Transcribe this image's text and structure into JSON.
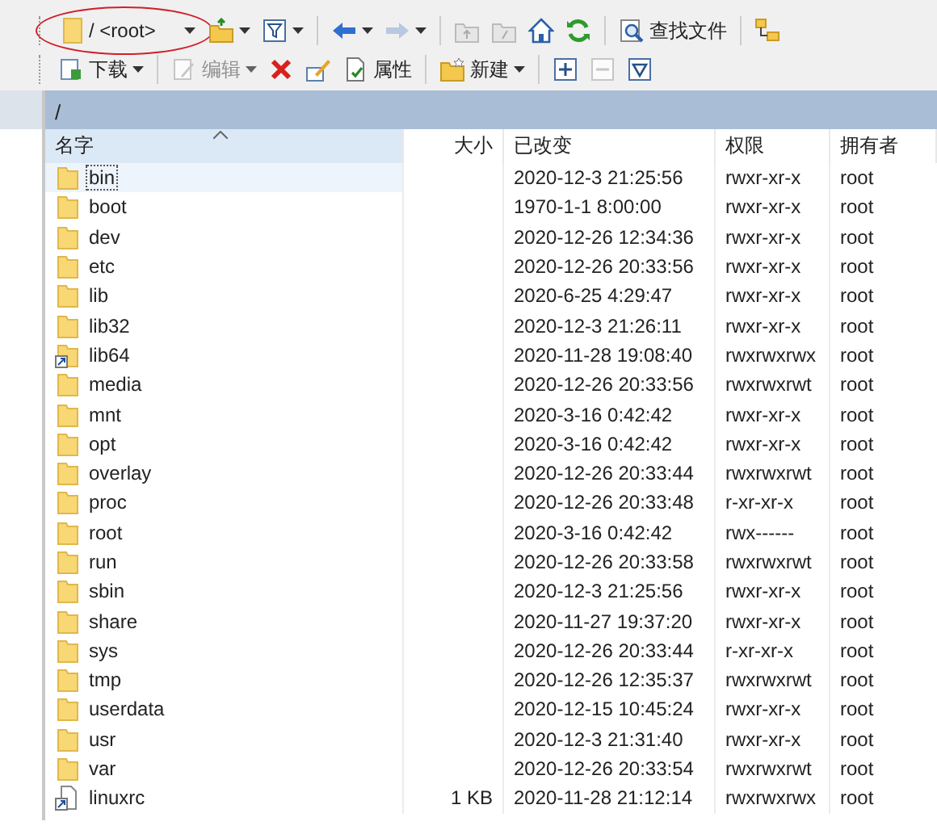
{
  "toolbar_top": {
    "path_combo": "/ <root>",
    "find_button": "查找文件",
    "back_enabled": true,
    "forward_enabled": false
  },
  "toolbar_bottom": [
    {
      "kind": "download",
      "label": "下载",
      "dropdown": true,
      "disabled": false
    },
    {
      "kind": "edit",
      "label": "编辑",
      "dropdown": true,
      "disabled": true
    },
    {
      "kind": "delete",
      "disabled": false
    },
    {
      "kind": "rename",
      "disabled": false
    },
    {
      "kind": "properties",
      "label": "属性",
      "disabled": false
    },
    {
      "kind": "new",
      "label": "新建",
      "dropdown": true,
      "disabled": false
    },
    {
      "kind": "plus",
      "disabled": false
    },
    {
      "kind": "minus",
      "disabled": true
    },
    {
      "kind": "select",
      "disabled": false
    }
  ],
  "path_bar": "/",
  "table": {
    "columns": [
      {
        "label": "名字",
        "sorted": true
      },
      {
        "label": "大小",
        "sorted": false
      },
      {
        "label": "已改变",
        "sorted": false
      },
      {
        "label": "权限",
        "sorted": false
      },
      {
        "label": "拥有者",
        "sorted": false
      }
    ],
    "rows": [
      {
        "kind": "folder",
        "name": "bin",
        "size": "",
        "modified": "2020-12-3 21:25:56",
        "perm": "rwxr-xr-x",
        "owner": "root",
        "selected": true
      },
      {
        "kind": "folder",
        "name": "boot",
        "size": "",
        "modified": "1970-1-1 8:00:00",
        "perm": "rwxr-xr-x",
        "owner": "root",
        "selected": false
      },
      {
        "kind": "folder",
        "name": "dev",
        "size": "",
        "modified": "2020-12-26 12:34:36",
        "perm": "rwxr-xr-x",
        "owner": "root",
        "selected": false
      },
      {
        "kind": "folder",
        "name": "etc",
        "size": "",
        "modified": "2020-12-26 20:33:56",
        "perm": "rwxr-xr-x",
        "owner": "root",
        "selected": false
      },
      {
        "kind": "folder",
        "name": "lib",
        "size": "",
        "modified": "2020-6-25 4:29:47",
        "perm": "rwxr-xr-x",
        "owner": "root",
        "selected": false
      },
      {
        "kind": "folder",
        "name": "lib32",
        "size": "",
        "modified": "2020-12-3 21:26:11",
        "perm": "rwxr-xr-x",
        "owner": "root",
        "selected": false
      },
      {
        "kind": "folder-link",
        "name": "lib64",
        "size": "",
        "modified": "2020-11-28 19:08:40",
        "perm": "rwxrwxrwx",
        "owner": "root",
        "selected": false
      },
      {
        "kind": "folder",
        "name": "media",
        "size": "",
        "modified": "2020-12-26 20:33:56",
        "perm": "rwxrwxrwt",
        "owner": "root",
        "selected": false
      },
      {
        "kind": "folder",
        "name": "mnt",
        "size": "",
        "modified": "2020-3-16 0:42:42",
        "perm": "rwxr-xr-x",
        "owner": "root",
        "selected": false
      },
      {
        "kind": "folder",
        "name": "opt",
        "size": "",
        "modified": "2020-3-16 0:42:42",
        "perm": "rwxr-xr-x",
        "owner": "root",
        "selected": false
      },
      {
        "kind": "folder",
        "name": "overlay",
        "size": "",
        "modified": "2020-12-26 20:33:44",
        "perm": "rwxrwxrwt",
        "owner": "root",
        "selected": false
      },
      {
        "kind": "folder",
        "name": "proc",
        "size": "",
        "modified": "2020-12-26 20:33:48",
        "perm": "r-xr-xr-x",
        "owner": "root",
        "selected": false
      },
      {
        "kind": "folder",
        "name": "root",
        "size": "",
        "modified": "2020-3-16 0:42:42",
        "perm": "rwx------",
        "owner": "root",
        "selected": false
      },
      {
        "kind": "folder",
        "name": "run",
        "size": "",
        "modified": "2020-12-26 20:33:58",
        "perm": "rwxrwxrwt",
        "owner": "root",
        "selected": false
      },
      {
        "kind": "folder",
        "name": "sbin",
        "size": "",
        "modified": "2020-12-3 21:25:56",
        "perm": "rwxr-xr-x",
        "owner": "root",
        "selected": false
      },
      {
        "kind": "folder",
        "name": "share",
        "size": "",
        "modified": "2020-11-27 19:37:20",
        "perm": "rwxr-xr-x",
        "owner": "root",
        "selected": false
      },
      {
        "kind": "folder",
        "name": "sys",
        "size": "",
        "modified": "2020-12-26 20:33:44",
        "perm": "r-xr-xr-x",
        "owner": "root",
        "selected": false
      },
      {
        "kind": "folder",
        "name": "tmp",
        "size": "",
        "modified": "2020-12-26 12:35:37",
        "perm": "rwxrwxrwt",
        "owner": "root",
        "selected": false
      },
      {
        "kind": "folder",
        "name": "userdata",
        "size": "",
        "modified": "2020-12-15 10:45:24",
        "perm": "rwxr-xr-x",
        "owner": "root",
        "selected": false
      },
      {
        "kind": "folder",
        "name": "usr",
        "size": "",
        "modified": "2020-12-3 21:31:40",
        "perm": "rwxr-xr-x",
        "owner": "root",
        "selected": false
      },
      {
        "kind": "folder",
        "name": "var",
        "size": "",
        "modified": "2020-12-26 20:33:54",
        "perm": "rwxrwxrwt",
        "owner": "root",
        "selected": false
      },
      {
        "kind": "file-link",
        "name": "linuxrc",
        "size": "1 KB",
        "modified": "2020-11-28 21:12:14",
        "perm": "rwxrwxrwx",
        "owner": "root",
        "selected": false
      }
    ]
  }
}
